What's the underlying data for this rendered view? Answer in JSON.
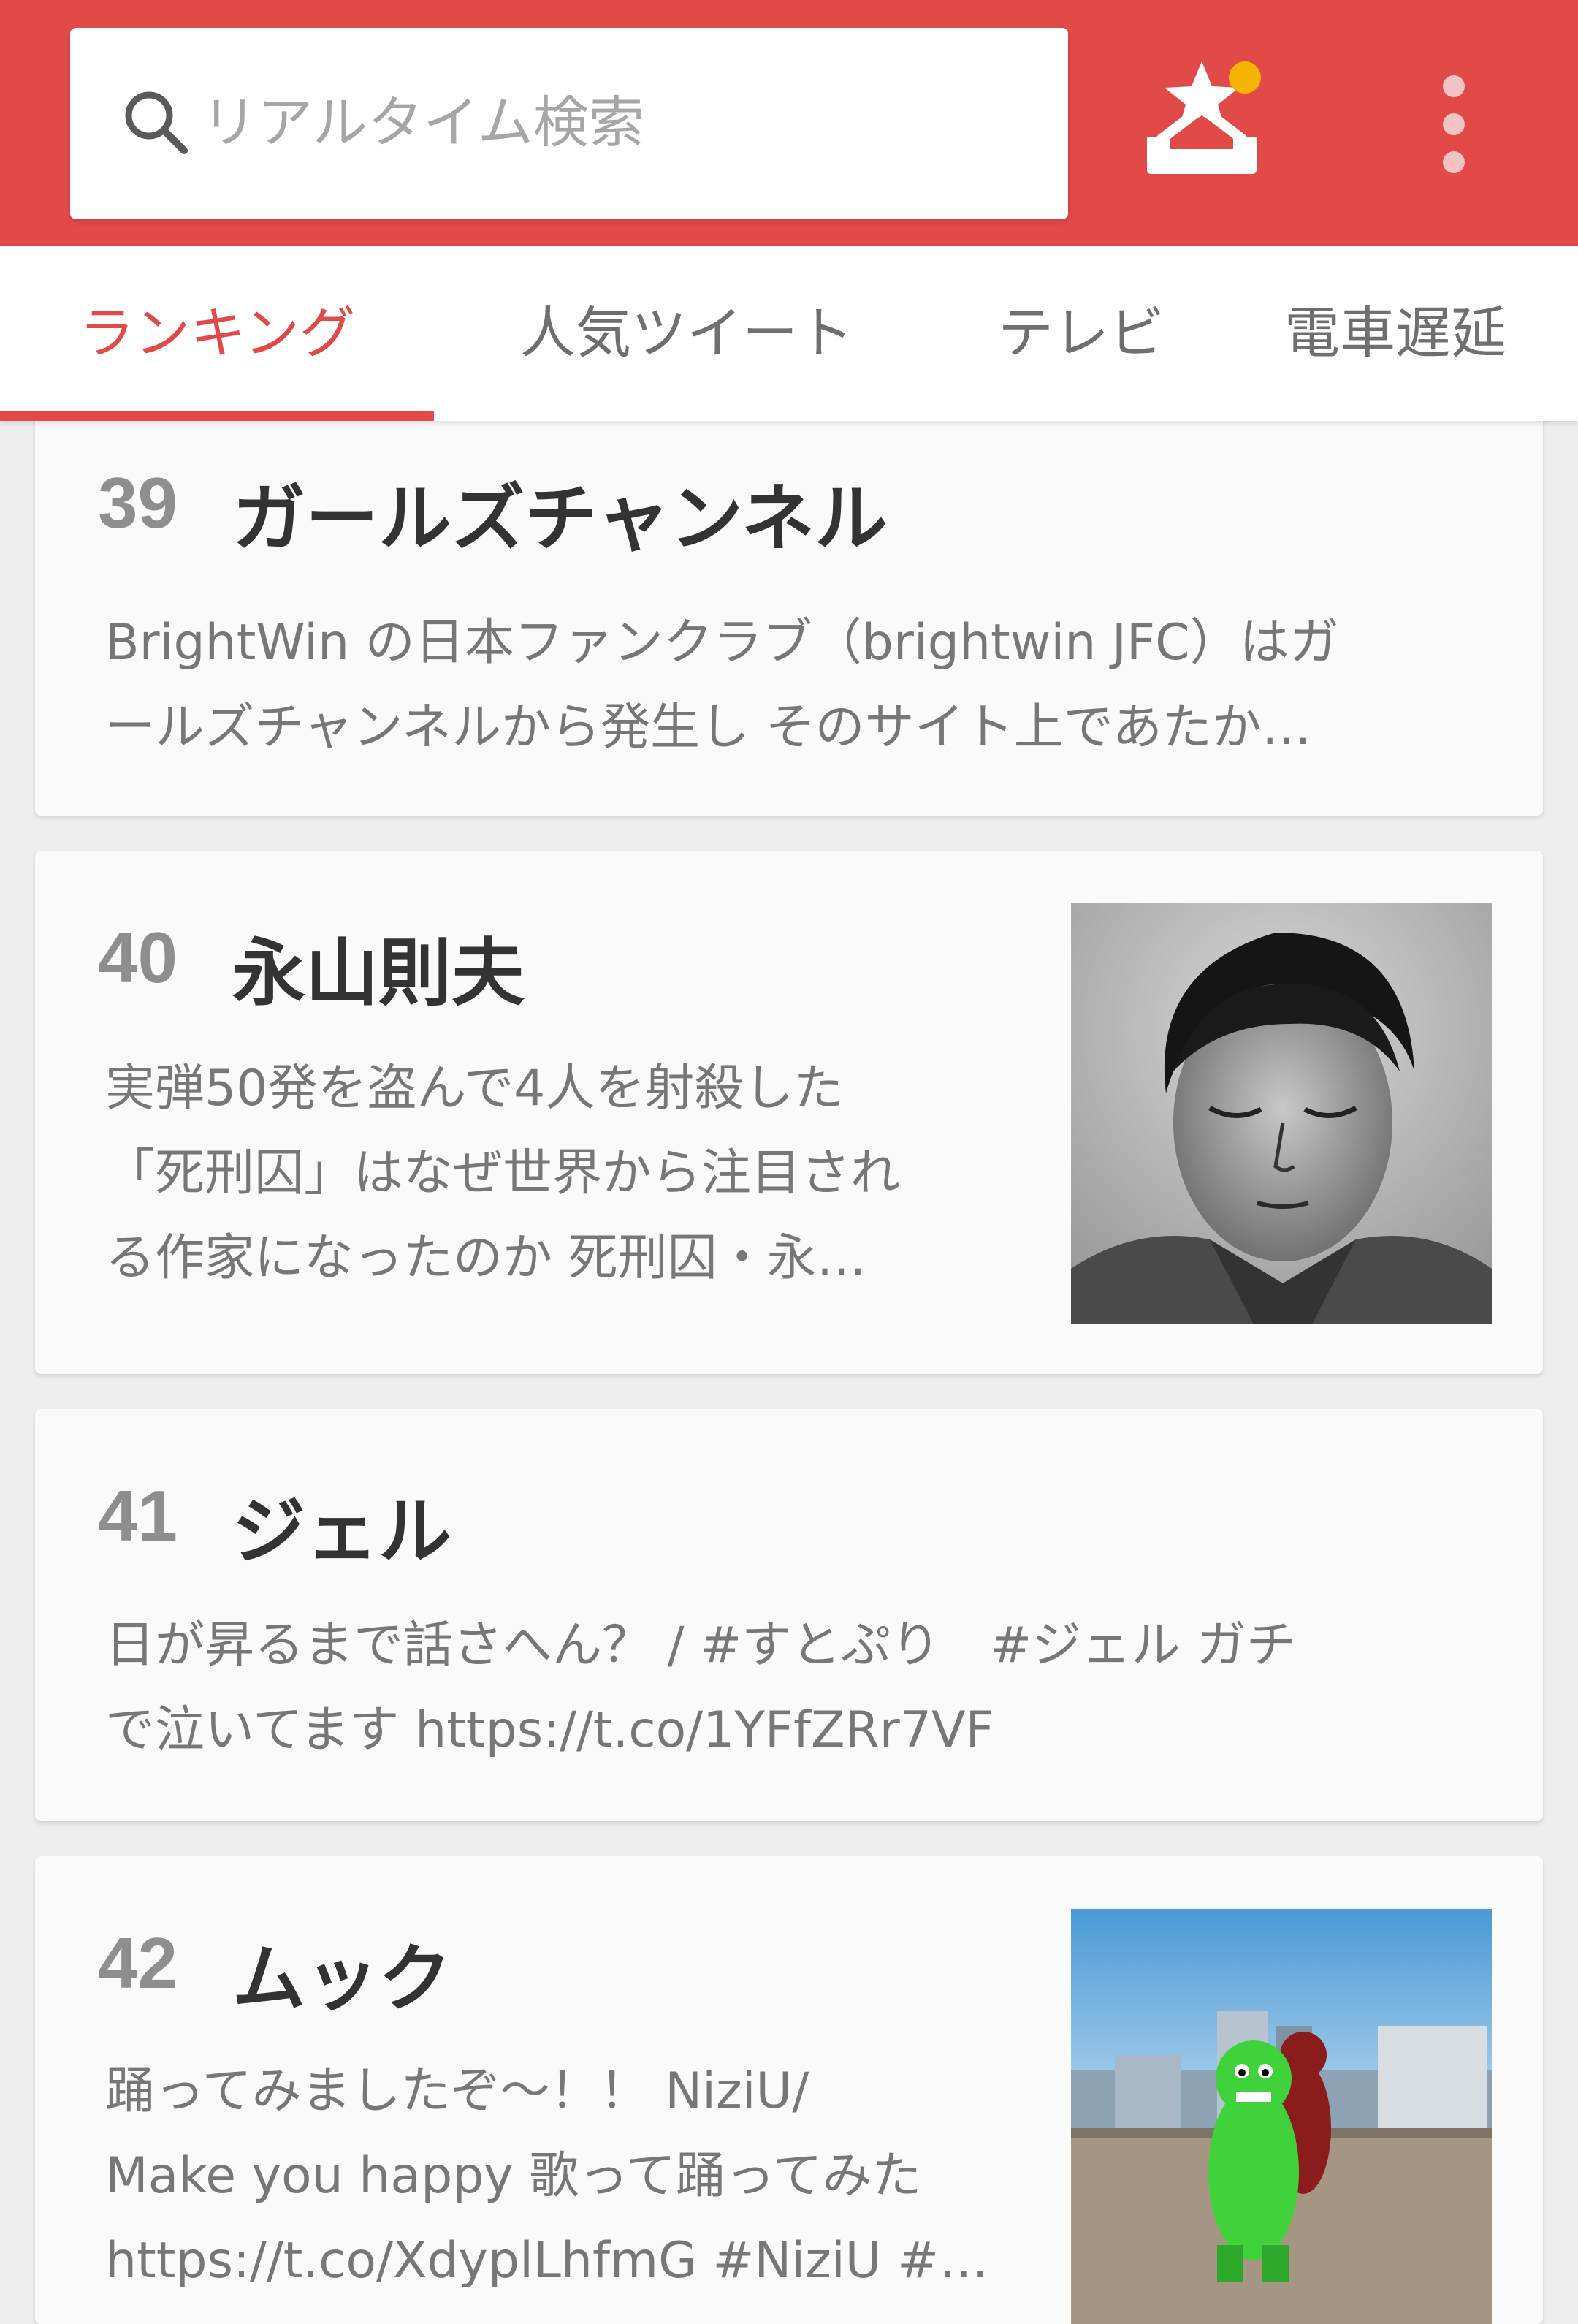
{
  "search": {
    "placeholder": "リアルタイム検索",
    "icon": "search-icon"
  },
  "header": {
    "favorites_icon": "star-inbox-icon",
    "menu_icon": "more-vertical-icon",
    "notification_dot_color": "#f5b400",
    "bar_color": "#e24a48"
  },
  "tabs": [
    {
      "label": "ランキング",
      "active": true
    },
    {
      "label": "人気ツイート",
      "active": false
    },
    {
      "label": "テレビ",
      "active": false
    },
    {
      "label": "電車遅延",
      "active": false
    }
  ],
  "rankings": [
    {
      "rank": "39",
      "title": "ガールズチャンネル",
      "desc_lines": [
        "BrightWin の日本ファンクラブ（brightwin JFC）はガ",
        "ールズチャンネルから発生し そのサイト上であたか…"
      ]
    },
    {
      "rank": "40",
      "title": "永山則夫",
      "desc_lines": [
        "実弾50発を盗んで4人を射殺した",
        "「死刑囚」はなぜ世界から注目され",
        "る作家になったのか 死刑囚・永…"
      ],
      "thumbnail": "black-and-white-portrait"
    },
    {
      "rank": "41",
      "title": "ジェル",
      "desc_lines": [
        "日が昇るまで話さへん？ / #すとぷり　#ジェル ガチ",
        "で泣いてます https://t.co/1YFfZRr7VF"
      ]
    },
    {
      "rank": "42",
      "title": "ムック",
      "desc_lines": [
        "踊ってみましたぞ〜！！ NiziU/",
        "Make you happy 歌って踊ってみた",
        "https://t.co/XdyplLhfmG #NiziU #…"
      ],
      "thumbnail": "mascots-on-rooftop"
    }
  ]
}
